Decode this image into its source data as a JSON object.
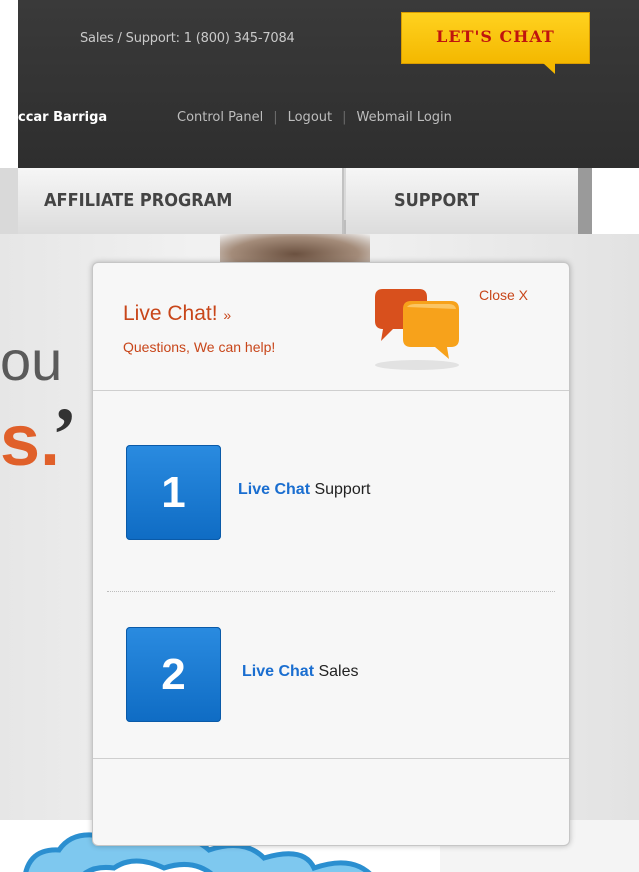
{
  "header": {
    "sales_support": "Sales / Support: 1 (800) 345-7084",
    "chat_button": "LET'S CHAT",
    "user_name": "ccar Barriga",
    "links": [
      "Control Panel",
      "Logout",
      "Webmail Login"
    ],
    "separator": "|"
  },
  "nav": {
    "items": [
      {
        "label": "AFFILIATE PROGRAM"
      },
      {
        "label": "SUPPORT"
      }
    ]
  },
  "background": {
    "text_ou": "ou",
    "text_s": "s.",
    "quote": "’"
  },
  "popup": {
    "title": "Live Chat!",
    "title_suffix": "»",
    "subtitle": "Questions, We can help!",
    "close": "Close X",
    "options": [
      {
        "number": "1",
        "highlight": "Live Chat",
        "label": " Support"
      },
      {
        "number": "2",
        "highlight": "Live Chat",
        "label": " Sales"
      }
    ]
  },
  "colors": {
    "accent_orange": "#c8461a",
    "chat_button_yellow": "#ffd21f",
    "chat_button_text": "#c0140e",
    "option_blue": "#1a6ed0",
    "header_dark": "#333333"
  },
  "icons": [
    "chat-bubbles-icon"
  ]
}
